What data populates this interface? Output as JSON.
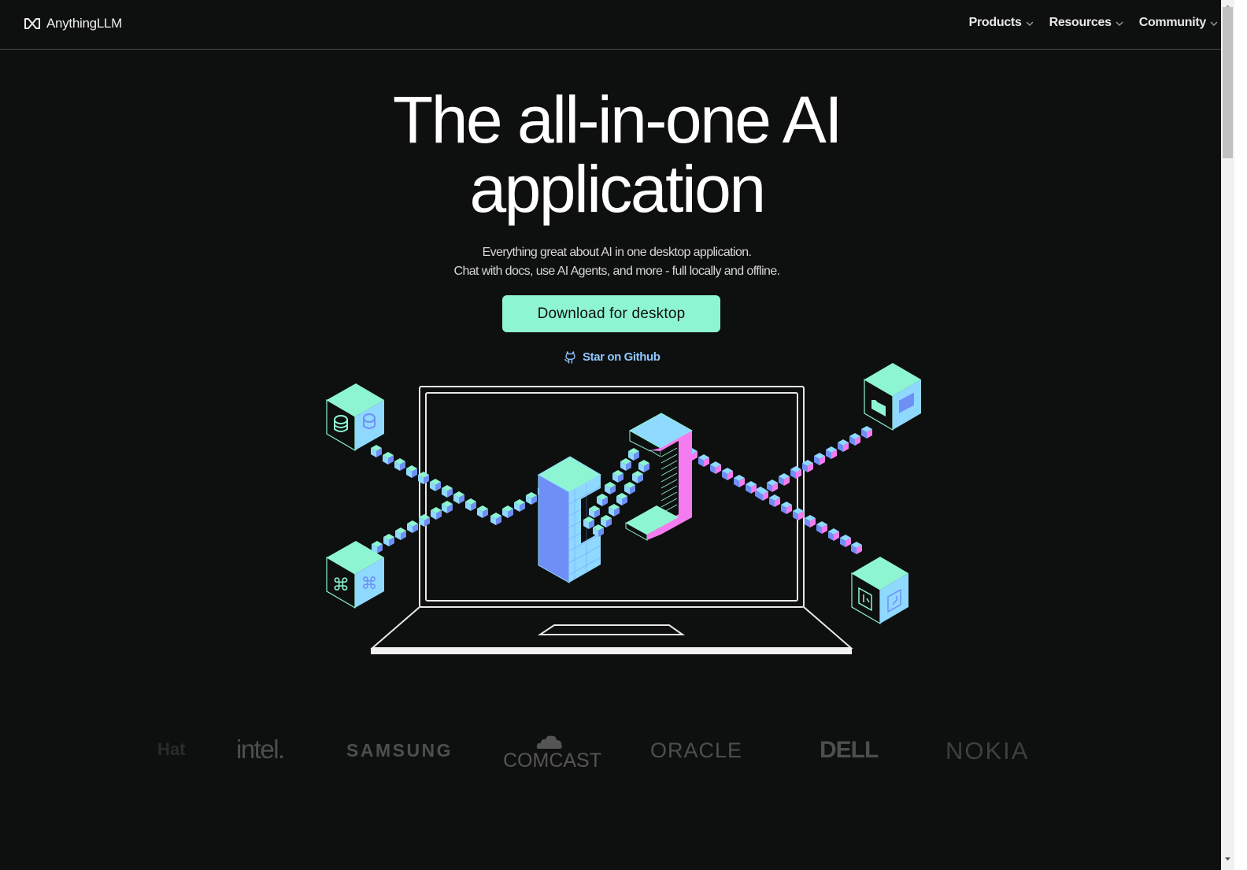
{
  "header": {
    "brand": "AnythingLLM",
    "brand_icon": "infinity-logo-icon",
    "nav": [
      {
        "label": "Products",
        "icon": "chevron-down-icon"
      },
      {
        "label": "Resources",
        "icon": "chevron-down-icon"
      },
      {
        "label": "Community",
        "icon": "chevron-down-icon"
      }
    ]
  },
  "hero": {
    "title_line1": "The all-in-one AI",
    "title_line2": "application",
    "subtitle_line1": "Everything great about AI in one desktop application.",
    "subtitle_line2": "Chat with docs, use AI Agents, and more - full locally and offline.",
    "cta_label": "Download for desktop",
    "github_label": "Star on Github",
    "github_icon": "github-octocat-icon"
  },
  "illustration": {
    "description": "Isometric laptop with AnythingLLM logo connected to four data cubes",
    "cubes": [
      {
        "position": "top-left",
        "icon": "database-icon"
      },
      {
        "position": "bottom-left",
        "icon": "command-key-icon"
      },
      {
        "position": "top-right",
        "icon": "binary-file-icon"
      },
      {
        "position": "bottom-right",
        "icon": "circuit-file-icon"
      }
    ]
  },
  "logos": [
    "Red Hat",
    "intel.",
    "SAMSUNG",
    "COMCAST",
    "ORACLE",
    "DELL",
    "NOKIA"
  ],
  "logo_display": {
    "redhat": "Hat",
    "intel": "intel.",
    "samsung": "SAMSUNG",
    "comcast": "COMCAST",
    "oracle": "ORACLE",
    "dell": "DELL",
    "nokia": "NOKIA"
  },
  "colors": {
    "background": "#0e0f0f",
    "cta": "#8ef5d2",
    "github_link": "#8ec8ff",
    "mint": "#8ef5d2",
    "sky": "#8fd9ff",
    "periwinkle": "#6f8ff7",
    "pink": "#f57cf0"
  }
}
